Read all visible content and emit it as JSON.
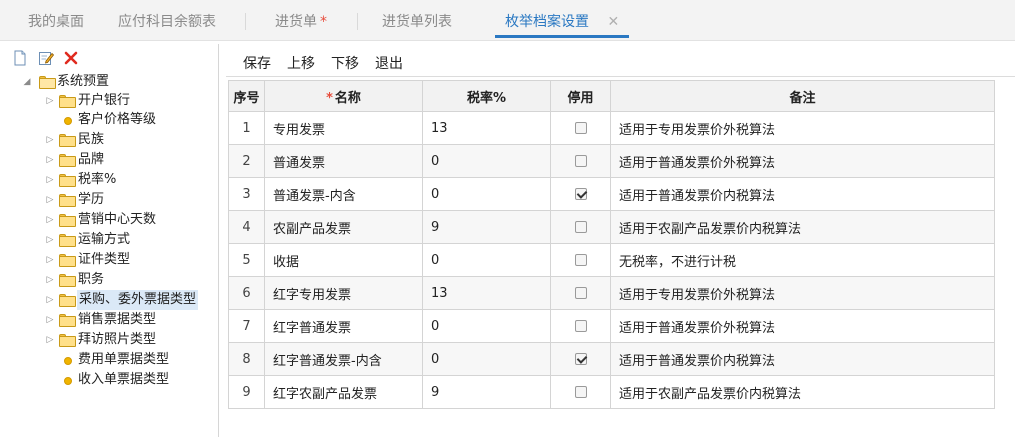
{
  "tabs": [
    {
      "label": "我的桌面",
      "active": false,
      "modified": false
    },
    {
      "label": "应付科目余额表",
      "active": false,
      "modified": false
    },
    {
      "label": "进货单",
      "active": false,
      "modified": true,
      "modified_mark": "*"
    },
    {
      "label": "进货单列表",
      "active": false,
      "modified": false
    },
    {
      "label": "枚举档案设置",
      "active": true,
      "modified": false,
      "close_glyph": "✕"
    }
  ],
  "tree_toolbar": {
    "icons": [
      "new-document-icon",
      "edit-icon",
      "delete-icon"
    ]
  },
  "tree": {
    "root": {
      "label": "系统预置",
      "expanded": true
    },
    "children": [
      {
        "label": "开户银行",
        "type": "folder"
      },
      {
        "label": "客户价格等级",
        "type": "leaf"
      },
      {
        "label": "民族",
        "type": "folder"
      },
      {
        "label": "品牌",
        "type": "folder"
      },
      {
        "label": "税率%",
        "type": "folder"
      },
      {
        "label": "学历",
        "type": "folder"
      },
      {
        "label": "营销中心天数",
        "type": "folder"
      },
      {
        "label": "运输方式",
        "type": "folder"
      },
      {
        "label": "证件类型",
        "type": "folder"
      },
      {
        "label": "职务",
        "type": "folder"
      },
      {
        "label": "采购、委外票据类型",
        "type": "folder",
        "selected": true
      },
      {
        "label": "销售票据类型",
        "type": "folder"
      },
      {
        "label": "拜访照片类型",
        "type": "folder"
      },
      {
        "label": "费用单票据类型",
        "type": "leaf"
      },
      {
        "label": "收入单票据类型",
        "type": "leaf"
      }
    ]
  },
  "toolbar": {
    "save": "保存",
    "move_up": "上移",
    "move_down": "下移",
    "exit": "退出"
  },
  "grid": {
    "columns": {
      "index": "序号",
      "name_required_mark": "*",
      "name": "名称",
      "tax_rate": "税率%",
      "disabled": "停用",
      "remark": "备注"
    },
    "rows": [
      {
        "index": "1",
        "name": "专用发票",
        "tax_rate": "13",
        "disabled": false,
        "remark": "适用于专用发票价外税算法"
      },
      {
        "index": "2",
        "name": "普通发票",
        "tax_rate": "0",
        "disabled": false,
        "remark": "适用于普通发票价外税算法"
      },
      {
        "index": "3",
        "name": "普通发票-内含",
        "tax_rate": "0",
        "disabled": true,
        "remark": "适用于普通发票价内税算法"
      },
      {
        "index": "4",
        "name": "农副产品发票",
        "tax_rate": "9",
        "disabled": false,
        "remark": "适用于农副产品发票价内税算法"
      },
      {
        "index": "5",
        "name": "收据",
        "tax_rate": "0",
        "disabled": false,
        "remark": "无税率，不进行计税"
      },
      {
        "index": "6",
        "name": "红字专用发票",
        "tax_rate": "13",
        "disabled": false,
        "remark": "适用于专用发票价外税算法"
      },
      {
        "index": "7",
        "name": "红字普通发票",
        "tax_rate": "0",
        "disabled": false,
        "remark": "适用于普通发票价外税算法"
      },
      {
        "index": "8",
        "name": "红字普通发票-内含",
        "tax_rate": "0",
        "disabled": true,
        "remark": "适用于普通发票价内税算法"
      },
      {
        "index": "9",
        "name": "红字农副产品发票",
        "tax_rate": "9",
        "disabled": false,
        "remark": "适用于农副产品发票价内税算法"
      }
    ]
  },
  "colors": {
    "accent": "#2a78c2",
    "required": "#e74c3c",
    "selected_bg": "#dbe9f7",
    "folder": "#ffe08a",
    "leaf_bullet": "#f0b400"
  }
}
